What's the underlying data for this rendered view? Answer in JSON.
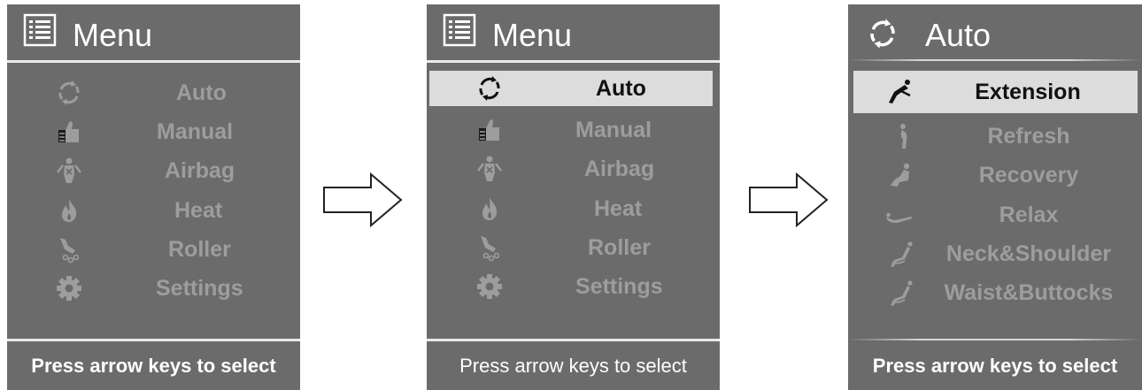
{
  "panels": [
    {
      "title": "Menu",
      "header_icon": "list-icon",
      "items": [
        {
          "label": "Auto",
          "icon": "cycle-icon"
        },
        {
          "label": "Manual",
          "icon": "thumbs-up-icon"
        },
        {
          "label": "Airbag",
          "icon": "airbag-body-icon"
        },
        {
          "label": "Heat",
          "icon": "flame-icon"
        },
        {
          "label": "Roller",
          "icon": "roller-icon"
        },
        {
          "label": "Settings",
          "icon": "gear-icon"
        }
      ],
      "footer": "Press arrow keys to select"
    },
    {
      "title": "Menu",
      "header_icon": "list-icon",
      "selected_index": 0,
      "items": [
        {
          "label": "Auto",
          "icon": "cycle-icon"
        },
        {
          "label": "Manual",
          "icon": "thumbs-up-icon"
        },
        {
          "label": "Airbag",
          "icon": "airbag-body-icon"
        },
        {
          "label": "Heat",
          "icon": "flame-icon"
        },
        {
          "label": "Roller",
          "icon": "roller-icon"
        },
        {
          "label": "Settings",
          "icon": "gear-icon"
        }
      ],
      "footer": "Press arrow keys to select"
    },
    {
      "title": "Auto",
      "header_icon": "cycle-icon",
      "selected_index": 0,
      "items": [
        {
          "label": "Extension",
          "icon": "stretch-figure-icon"
        },
        {
          "label": "Refresh",
          "icon": "standing-figure-icon"
        },
        {
          "label": "Recovery",
          "icon": "sitting-figure-icon"
        },
        {
          "label": "Relax",
          "icon": "reclined-figure-icon"
        },
        {
          "label": "Neck&Shoulder",
          "icon": "neck-shoulder-figure-icon"
        },
        {
          "label": "Waist&Buttocks",
          "icon": "waist-buttocks-figure-icon"
        }
      ],
      "footer": "Press arrow keys to select"
    }
  ],
  "colors": {
    "panel_bg": "#6b6b6b",
    "item_text": "#9d9d9d",
    "selected_bg": "#dcdcdc",
    "selected_text": "#111111",
    "header_text": "#ffffff"
  }
}
